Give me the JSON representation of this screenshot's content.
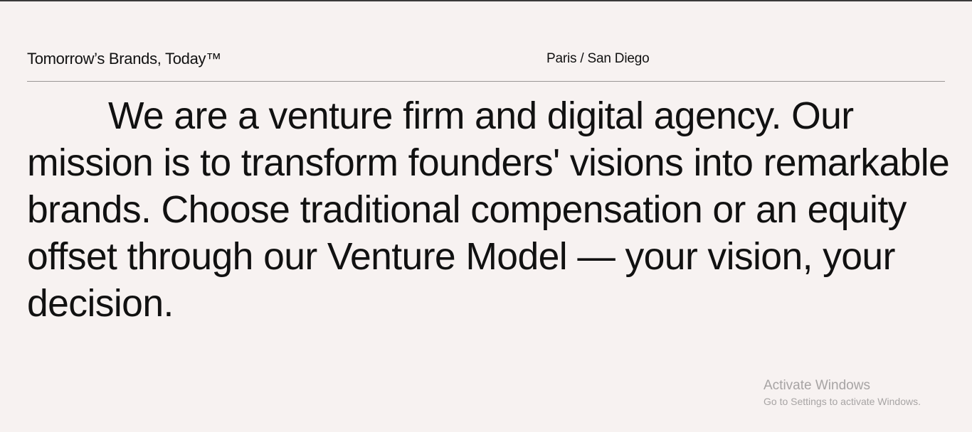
{
  "header": {
    "tagline": "Tomorrow’s Brands, Today™",
    "location": "Paris / San Diego"
  },
  "main": {
    "intro": "We are a venture firm and digital agency. Our mission is to transform founders' visions into remarkable brands. Choose traditional compensation or an equity offset through our Venture Model — your vision, your decision."
  },
  "windows_watermark": {
    "title": "Activate Windows",
    "subtitle": "Go to Settings to activate Windows."
  }
}
